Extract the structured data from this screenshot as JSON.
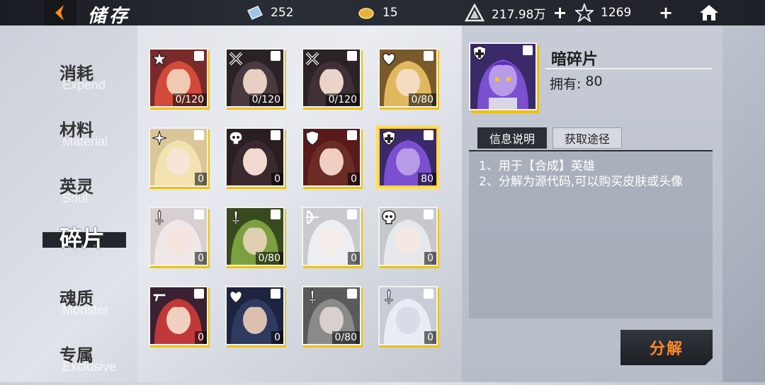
{
  "header": {
    "title": "储存",
    "resources": [
      {
        "icon": "ticket-icon",
        "value": "252",
        "has_plus": false
      },
      {
        "icon": "coin-icon",
        "value": "15",
        "has_plus": false
      },
      {
        "icon": "gold-triangle-icon",
        "value": "217.98万",
        "has_plus": true
      },
      {
        "icon": "star-crystal-icon",
        "value": "1269",
        "has_plus": true
      }
    ]
  },
  "categories": [
    {
      "cn": "消耗",
      "en": "Expend",
      "active": false
    },
    {
      "cn": "材料",
      "en": "Material",
      "active": false
    },
    {
      "cn": "英灵",
      "en": "Soul",
      "active": false
    },
    {
      "cn": "碎片",
      "en": "Debris",
      "active": true
    },
    {
      "cn": "魂质",
      "en": "Monster",
      "active": false
    },
    {
      "cn": "专属",
      "en": "Exclusive",
      "active": false
    }
  ],
  "items": [
    {
      "count": "0/120",
      "class": "star-icon"
    },
    {
      "count": "0/120",
      "class": "cross-icon"
    },
    {
      "count": "0/120",
      "class": "cross-icon"
    },
    {
      "count": "0/80",
      "class": "heart-icon"
    },
    {
      "count": "0",
      "class": "flower-icon"
    },
    {
      "count": "0",
      "class": "skull-icon"
    },
    {
      "count": "0",
      "class": "shield-icon"
    },
    {
      "count": "80",
      "class": "cross-shield-icon",
      "selected": true
    },
    {
      "count": "0",
      "class": "sword-icon"
    },
    {
      "count": "0/80",
      "class": "sword-icon"
    },
    {
      "count": "0",
      "class": "bow-icon"
    },
    {
      "count": "0",
      "class": "skull-icon"
    },
    {
      "count": "0",
      "class": "gun-icon"
    },
    {
      "count": "0",
      "class": "heart-icon"
    },
    {
      "count": "0/80",
      "class": "sword-icon"
    },
    {
      "count": "0",
      "class": "sword-icon"
    }
  ],
  "detail": {
    "name": "暗碎片",
    "owned_label": "拥有:",
    "owned_value": "80",
    "tab_info": "信息说明",
    "tab_source": "获取途径",
    "desc_lines": [
      "1、用于【合成】英雄",
      "2、分解为源代码,可以购买皮肤或头像"
    ],
    "decompose_label": "分解"
  },
  "colors": {
    "accent_yellow": "#f0c200",
    "button_text_orange": "#ff8a2a",
    "header_dark": "#1a1d23"
  }
}
